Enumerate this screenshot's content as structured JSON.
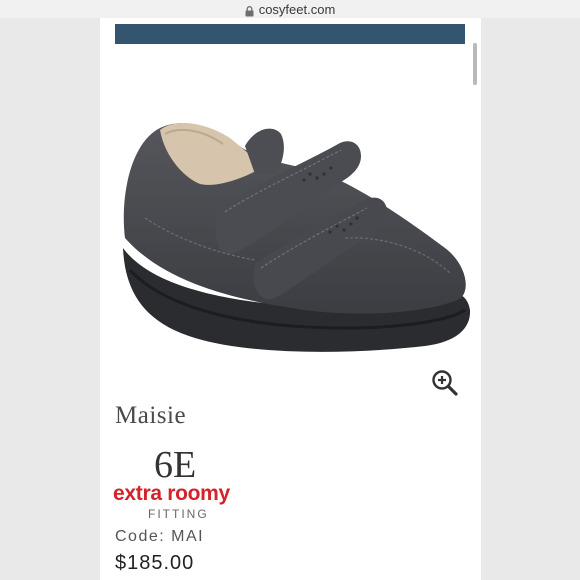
{
  "browser": {
    "url": "cosyfeet.com",
    "lock_icon": "lock-icon"
  },
  "product": {
    "name": "Maisie",
    "fit_size": "6E",
    "fit_label": "extra roomy",
    "fit_sub": "FITTING",
    "code": "Code: MAI",
    "price": "$185.00",
    "zoom_icon": "zoom-in-icon"
  },
  "colors": {
    "banner": "#33556f",
    "fit_label": "#d3222a"
  }
}
